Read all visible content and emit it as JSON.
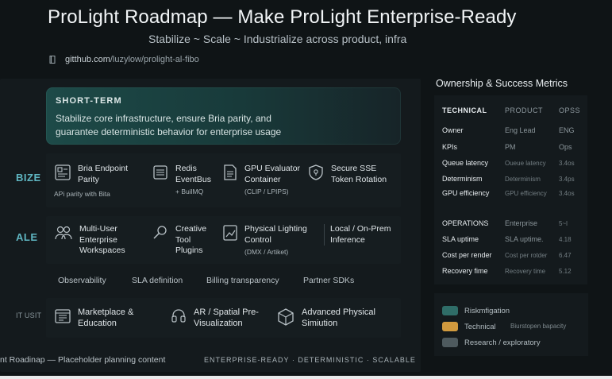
{
  "header": {
    "title": "ProLight Roadmap — Make ProLight Enterprise-Ready",
    "subtitle": "Stabilize ~ Scale ~ Industrialize across product, infra",
    "url_host": "gitthub.com",
    "url_path": "/luzylow/prolight-al-fibo"
  },
  "short_term": {
    "title": "SHORT-TERM",
    "description": "Stabilize core infrastructure, ensure Bria parity, and guarantee deterministic behavior for enterprise usage"
  },
  "rows": {
    "stabilize": {
      "label": "BIZE",
      "items": [
        {
          "title": "Bria Endpoint Parity",
          "sub": "APi parity with Bita",
          "icon": "document-icon"
        },
        {
          "title": "Redis EventBus",
          "sub": "+ BuilMQ",
          "icon": "server-icon"
        },
        {
          "title": "GPU Evaluator Container",
          "sub": "(CLIP / LPIPS)",
          "icon": "file-icon"
        },
        {
          "title": "Secure SSE Token Rotation",
          "sub": "",
          "icon": "shield-icon"
        }
      ]
    },
    "scale": {
      "label": "ALE",
      "items": [
        {
          "title": "Multi-User Enterprise Workspaces",
          "sub": "",
          "icon": "users-icon"
        },
        {
          "title": "Creative Tool Plugins",
          "sub": "",
          "icon": "wand-icon"
        },
        {
          "title": "Physical Lighting Control",
          "sub": "(DMX / Artiket)",
          "icon": "chart-icon"
        },
        {
          "title": "Local / On-Prem Inference",
          "sub": "",
          "icon": "none"
        }
      ],
      "pills": [
        "Observability",
        "SLA definition",
        "Billing transparency",
        "Partner SDKs"
      ]
    },
    "industrialize": {
      "label": "IT USIT",
      "items": [
        {
          "title": "Marketplace & Education",
          "icon": "book-icon"
        },
        {
          "title": "AR / Spatial Pre-Visualization",
          "icon": "headset-icon"
        },
        {
          "title": "Advanced Physical Simiution",
          "icon": "cube-icon"
        }
      ]
    }
  },
  "footer": {
    "text": "nt Roadinap — Placeholder planning content",
    "tags": "ENTERPRISE-READY · DETERMINISTIC · SCALABLE"
  },
  "metrics": {
    "title": "Ownership & Success Metrics",
    "columns": [
      "TECHNICAL",
      "PRODUCT",
      "OPSS"
    ],
    "technical_rows": [
      {
        "k": "Owner",
        "v1": "Eng Lead",
        "v2": "ENG"
      },
      {
        "k": "KPIs",
        "v1": "PM",
        "v2": "Ops"
      },
      {
        "k": "Queue latency",
        "v1": "Oueue latency",
        "v2": "3.4os"
      },
      {
        "k": "Determinism",
        "v1": "Determinism",
        "v2": "3.4ps"
      },
      {
        "k": "GPU efficiency",
        "v1": "GPU efficiency",
        "v2": "3.4os"
      }
    ],
    "operations_header": {
      "k": "OPERATIONS",
      "v1": "Enterprise",
      "v2": "5~l"
    },
    "operations_rows": [
      {
        "k": "SLA uptime",
        "v1": "SLA uptime.",
        "v2": "4.18"
      },
      {
        "k": "Cost per render",
        "v1": "Cost per rotder",
        "v2": "6.47"
      },
      {
        "k": "Recovery fime",
        "v1": "Recovery time",
        "v2": "5.12"
      }
    ]
  },
  "legend": {
    "items": [
      {
        "label": "Riskmfigation",
        "color": "#2f6d68"
      },
      {
        "label": "Technical",
        "color": "#d19a3e"
      },
      {
        "label": "Research / exploratory",
        "color": "#4e5a5e"
      }
    ],
    "extra": "Biurstopen bapacity"
  },
  "colors": {
    "background": "#0f1416",
    "accent": "#5fb6c2",
    "card": "#1d4a48"
  }
}
